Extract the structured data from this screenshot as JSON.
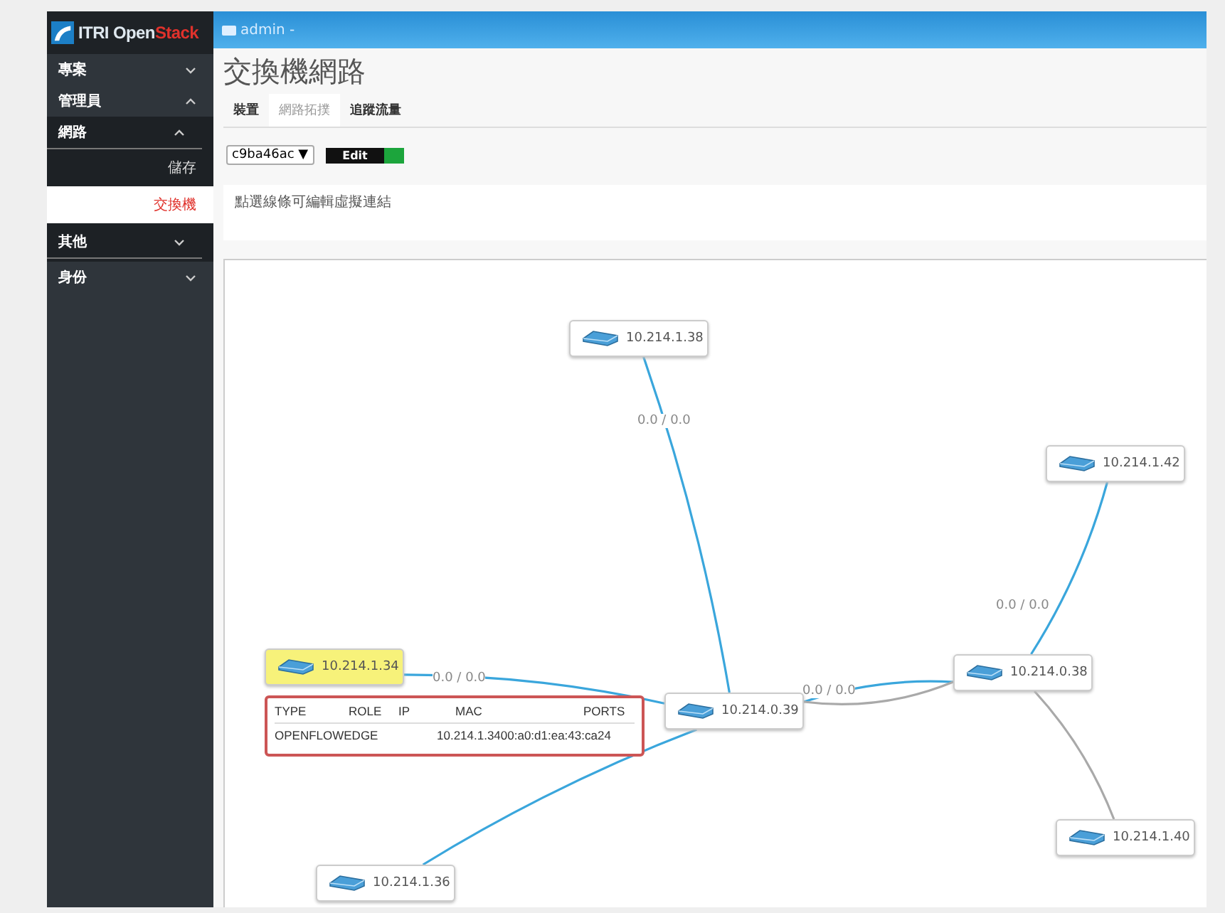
{
  "logo": {
    "text": "ITRI Open",
    "accent": "Stack"
  },
  "topbar": {
    "user": "admin -"
  },
  "sidebar": {
    "items": [
      {
        "label": "專案",
        "expanded": false
      },
      {
        "label": "管理員",
        "expanded": true,
        "children": [
          {
            "label": "網路",
            "expanded": true,
            "children": [
              {
                "label": "儲存",
                "selected": false
              },
              {
                "label": "交換機",
                "selected": true
              }
            ]
          },
          {
            "label": "其他",
            "expanded": false
          }
        ]
      },
      {
        "label": "身份",
        "expanded": false
      }
    ]
  },
  "page_title": "交換機網路",
  "tabs": [
    {
      "label": "裝置",
      "selected": false
    },
    {
      "label": "網路拓撲",
      "selected": true
    },
    {
      "label": "追蹤流量",
      "selected": false
    }
  ],
  "controller_select": {
    "value": "c9ba46ac",
    "arrow": "▼"
  },
  "edit_toggle": {
    "label": "Edit",
    "on": true
  },
  "note": "點選線條可編輯虛擬連結",
  "topology": {
    "nodes": [
      {
        "label": "10.214.1.38",
        "selected": false
      },
      {
        "label": "10.214.1.42",
        "selected": false
      },
      {
        "label": "10.214.0.38",
        "selected": false
      },
      {
        "label": "10.214.1.34",
        "selected": true
      },
      {
        "label": "10.214.0.39",
        "selected": false
      },
      {
        "label": "10.214.1.36",
        "selected": false
      },
      {
        "label": "10.214.1.40",
        "selected": false
      }
    ],
    "links": [
      {
        "color": "#3aa6dc",
        "label": "0.0 / 0.0"
      },
      {
        "color": "#3aa6dc",
        "label": "0.0 / 0.0"
      },
      {
        "color": "#3aa6dc"
      },
      {
        "color": "#3aa6dc",
        "label": "0.0 / 0.0"
      },
      {
        "color": "#a9a9a9"
      },
      {
        "color": "#3aa6dc",
        "label": "0.0 / 0.0"
      },
      {
        "color": "#a9a9a9"
      }
    ],
    "tooltip": {
      "headers": [
        "TYPE",
        "ROLE",
        "IP",
        "MAC",
        "PORTS"
      ],
      "values": [
        "OPENFLOWEDGE",
        "10.214.1.34",
        "00:a0:d1:ea:43:ca24"
      ]
    }
  }
}
